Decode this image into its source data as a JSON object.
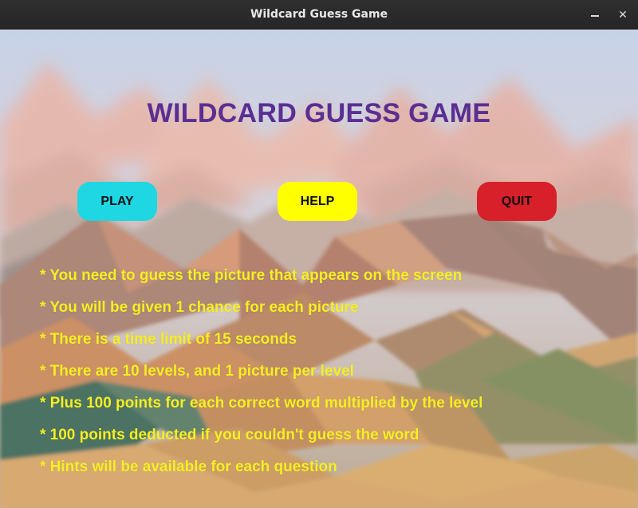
{
  "window": {
    "title": "Wildcard Guess Game",
    "minimize_icon": "minimize-icon",
    "close_icon": "close-icon",
    "close_glyph": "✕"
  },
  "game": {
    "heading": "WILDCARD GUESS GAME",
    "buttons": {
      "play": "PLAY",
      "help": "HELP",
      "quit": "QUIT"
    },
    "rules": [
      "* You need to guess the picture that appears on the screen",
      "* You will be given 1 chance for each picture",
      "* There is a time limit of 15 seconds",
      "* There are 10 levels, and 1 picture per level",
      "* Plus 100 points for each correct word multiplied by the level",
      "* 100 points deducted if you couldn't guess the word",
      "* Hints will be available for each question"
    ]
  },
  "colors": {
    "heading": "#5b2e91",
    "play_button": "#1fd6e3",
    "help_button": "#ffff00",
    "quit_button": "#d7202a",
    "rules_text": "#f6ef23",
    "titlebar": "#2b2b2b"
  }
}
